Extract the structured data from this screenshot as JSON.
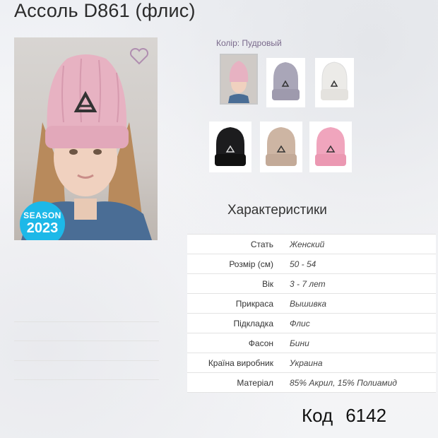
{
  "product": {
    "title": "Ассоль D861 (флис)",
    "season_badge": {
      "line1": "SEASON",
      "line2": "2023"
    },
    "favorite_icon": "heart-outline-icon"
  },
  "color": {
    "label": "Колір:",
    "value": "Пудровый",
    "swatches": [
      {
        "name": "powder",
        "hex": "#e8b8c4",
        "selected": true
      },
      {
        "name": "lilac-grey",
        "hex": "#a9a6b8"
      },
      {
        "name": "white",
        "hex": "#ecebe8"
      },
      {
        "name": "black",
        "hex": "#1c1c1e"
      },
      {
        "name": "beige",
        "hex": "#cdb5a3"
      },
      {
        "name": "pink",
        "hex": "#f0a5bd"
      }
    ]
  },
  "specs": {
    "title": "Характеристики",
    "rows": [
      {
        "label": "Стать",
        "value": "Женский"
      },
      {
        "label": "Розмір (см)",
        "value": "50 - 54"
      },
      {
        "label": "Вік",
        "value": "3 - 7 лет"
      },
      {
        "label": "Прикраса",
        "value": "Вышивка"
      },
      {
        "label": "Підкладка",
        "value": "Флис"
      },
      {
        "label": "Фасон",
        "value": "Бини"
      },
      {
        "label": "Країна виробник",
        "value": "Украина"
      },
      {
        "label": "Матеріал",
        "value": "85% Акрил, 15% Полиамид"
      }
    ]
  },
  "code": {
    "label": "Код",
    "value": "6142"
  }
}
